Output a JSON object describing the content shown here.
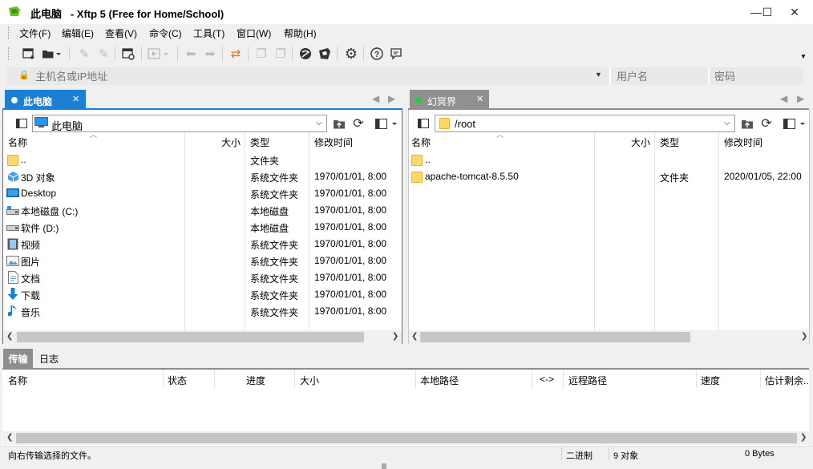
{
  "window": {
    "title": "此电脑   - Xftp 5 (Free for Home/School)",
    "minimize": "—",
    "maximize": "☐",
    "close": "✕"
  },
  "menu": [
    "文件(F)",
    "编辑(E)",
    "查看(V)",
    "命令(C)",
    "工具(T)",
    "窗口(W)",
    "帮助(H)"
  ],
  "address": {
    "host_placeholder": "主机名或IP地址",
    "user_placeholder": "用户名",
    "password_placeholder": "密码"
  },
  "tabs": {
    "left": {
      "label": "此电脑",
      "status_color": "#ffffff"
    },
    "right": {
      "label": "幻冥界",
      "status_color": "#28c840"
    }
  },
  "left_pane": {
    "path": "此电脑",
    "columns": [
      "名称",
      "大小",
      "类型",
      "修改时间"
    ],
    "rows": [
      {
        "name": "..",
        "size": "",
        "type": "文件夹",
        "modified": "",
        "icon": "folder-icon"
      },
      {
        "name": "3D 对象",
        "size": "",
        "type": "系统文件夹",
        "modified": "1970/01/01, 8:00",
        "icon": "cube-3d-icon"
      },
      {
        "name": "Desktop",
        "size": "",
        "type": "系统文件夹",
        "modified": "1970/01/01, 8:00",
        "icon": "desktop-icon"
      },
      {
        "name": "本地磁盘 (C:)",
        "size": "",
        "type": "本地磁盘",
        "modified": "1970/01/01, 8:00",
        "icon": "system-drive-icon"
      },
      {
        "name": "软件 (D:)",
        "size": "",
        "type": "本地磁盘",
        "modified": "1970/01/01, 8:00",
        "icon": "drive-icon"
      },
      {
        "name": "视频",
        "size": "",
        "type": "系统文件夹",
        "modified": "1970/01/01, 8:00",
        "icon": "video-icon"
      },
      {
        "name": "图片",
        "size": "",
        "type": "系统文件夹",
        "modified": "1970/01/01, 8:00",
        "icon": "pictures-icon"
      },
      {
        "name": "文档",
        "size": "",
        "type": "系统文件夹",
        "modified": "1970/01/01, 8:00",
        "icon": "documents-icon"
      },
      {
        "name": "下载",
        "size": "",
        "type": "系统文件夹",
        "modified": "1970/01/01, 8:00",
        "icon": "download-icon"
      },
      {
        "name": "音乐",
        "size": "",
        "type": "系统文件夹",
        "modified": "1970/01/01, 8:00",
        "icon": "music-icon"
      }
    ]
  },
  "right_pane": {
    "path": "/root",
    "columns": [
      "名称",
      "大小",
      "类型",
      "修改时间"
    ],
    "rows": [
      {
        "name": "..",
        "size": "",
        "type": "",
        "modified": "",
        "icon": "folder-icon"
      },
      {
        "name": "apache-tomcat-8.5.50",
        "size": "",
        "type": "文件夹",
        "modified": "2020/01/05, 22:00",
        "icon": "folder-icon"
      }
    ]
  },
  "transfer": {
    "tabs": [
      "传输",
      "日志"
    ],
    "columns": [
      "名称",
      "状态",
      "进度",
      "大小",
      "本地路径",
      "<->",
      "远程路径",
      "速度",
      "估计剩余..."
    ]
  },
  "status": {
    "message": "向右传输选择的文件。",
    "mode": "二进制",
    "count": "9 对象",
    "size": "0 Bytes"
  }
}
